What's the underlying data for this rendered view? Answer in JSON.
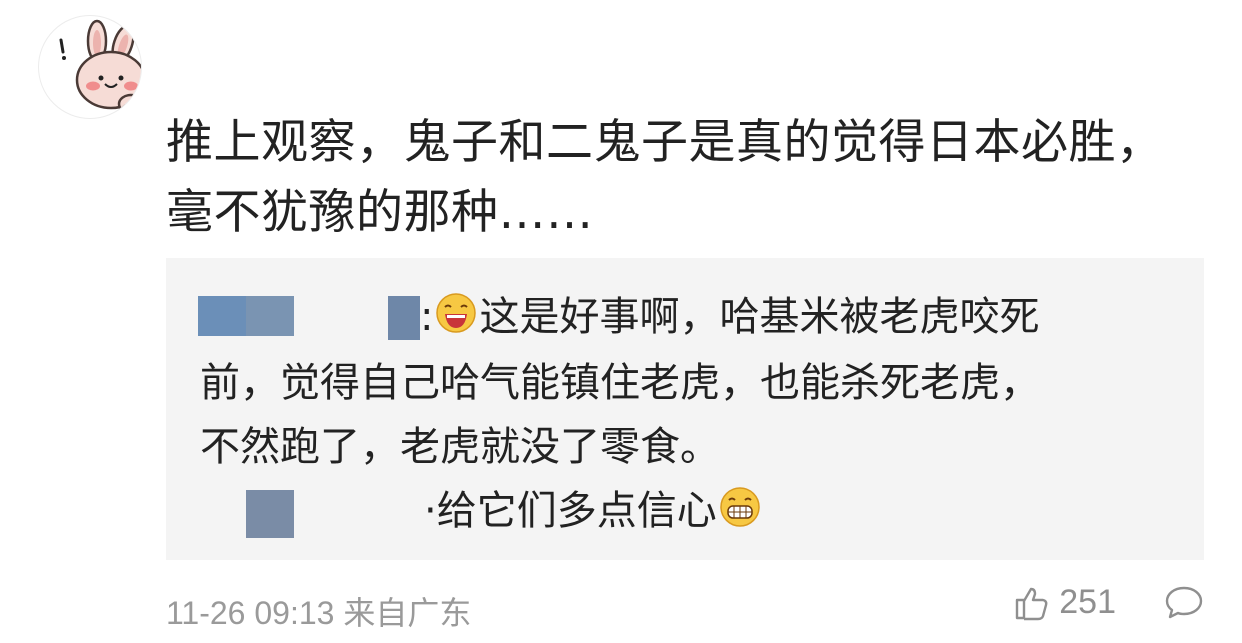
{
  "comment": {
    "avatar_icon": "cartoon-rabbit-icon",
    "text": "推上观察，鬼子和二鬼子是真的觉得日本必胜，毫不犹豫的那种……"
  },
  "reply": {
    "line1": "这是好事啊，哈基米被老虎咬死",
    "line2": "前，觉得自己哈气能镇住老虎，也能杀死老虎，",
    "line3": "不然跑了，老虎就没了零食。",
    "line4": "给它们多点信心",
    "emoji1": "laughing-face-icon",
    "emoji2": "grinning-face-icon"
  },
  "meta": {
    "timestamp": "11-26 09:13",
    "location": "来自广东"
  },
  "actions": {
    "like_icon": "thumbs-up-icon",
    "like_count": "251",
    "comment_icon": "comment-bubble-icon"
  }
}
